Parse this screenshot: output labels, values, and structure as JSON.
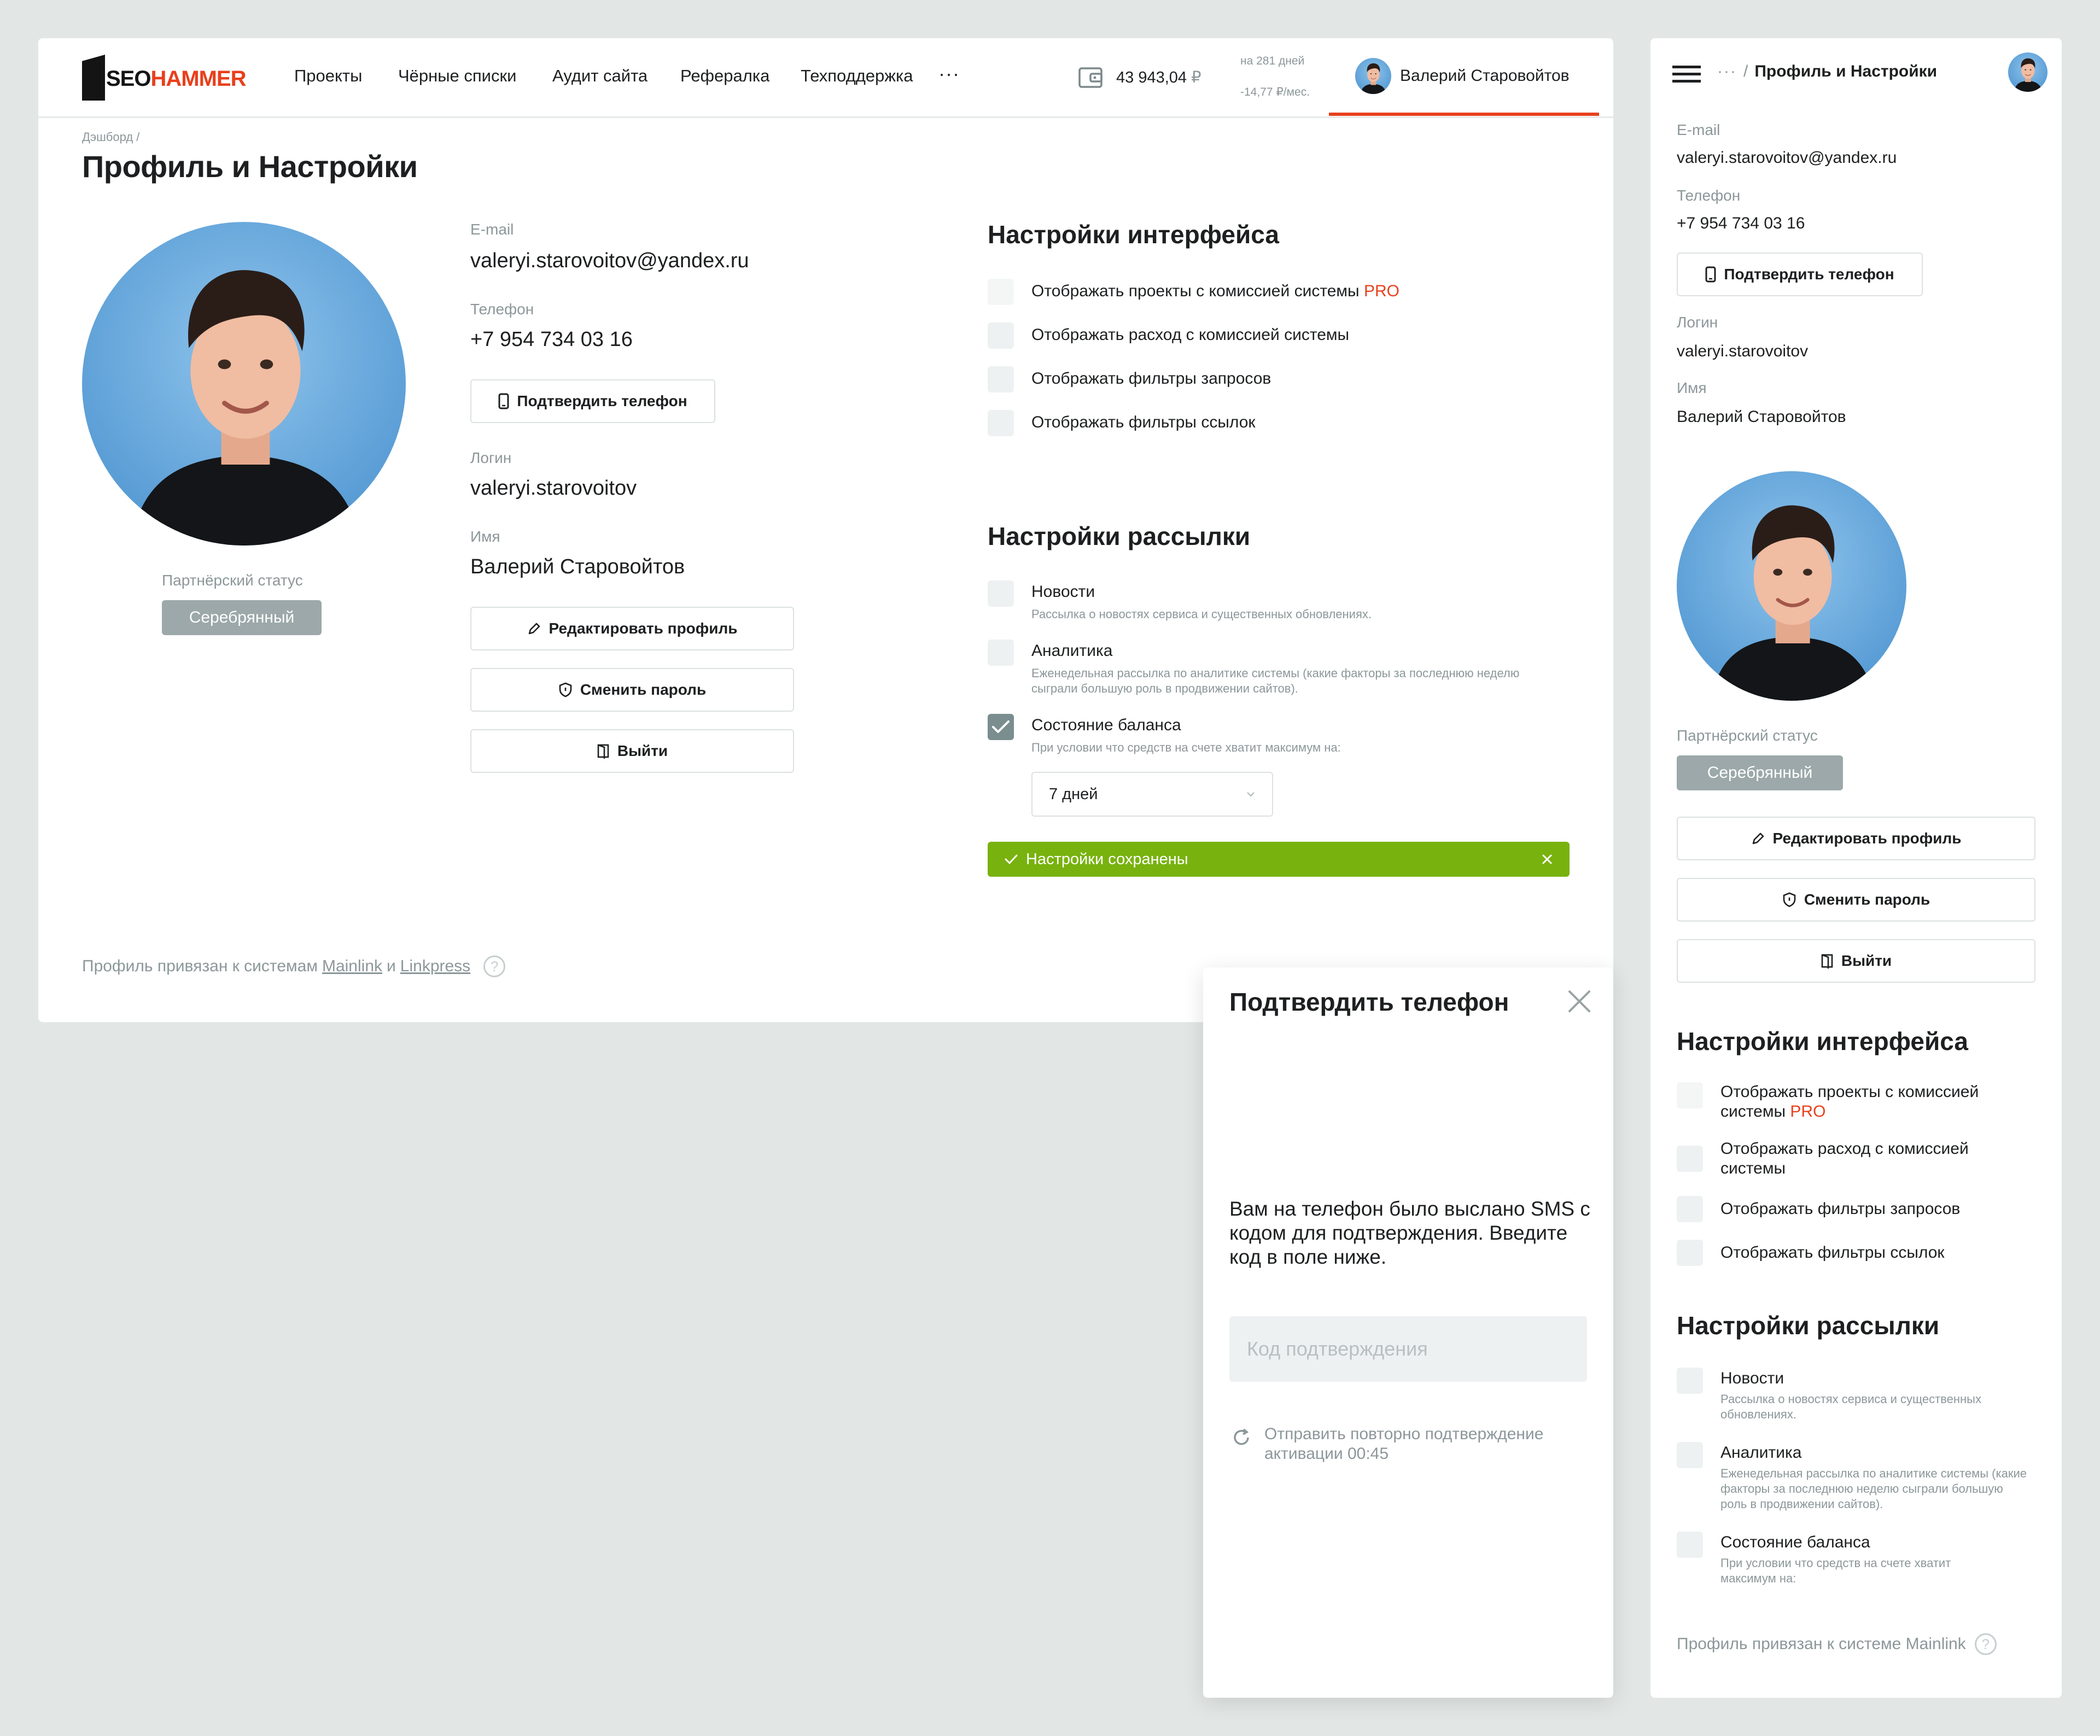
{
  "logo": {
    "part1": "SEO",
    "part2": "HAMMER"
  },
  "nav": {
    "items": [
      "Проекты",
      "Чёрные списки",
      "Аудит сайта",
      "Рефералка",
      "Техподдержка"
    ],
    "more": "···"
  },
  "wallet": {
    "amount": "43 943,04",
    "currency": "₽",
    "days": "на 281 дней",
    "per_month": "-14,77 ₽/мес."
  },
  "user": {
    "name": "Валерий Старовойтов"
  },
  "breadcrumb": "Дэшборд /",
  "page_title": "Профиль и Настройки",
  "profile": {
    "partner_status_label": "Партнёрский статус",
    "partner_status_value": "Серебрянный",
    "email_label": "E-mail",
    "email": "valeryi.starovoitov@yandex.ru",
    "phone_label": "Телефон",
    "phone": "+7 954 734 03 16",
    "confirm_phone_button": "Подтвердить телефон",
    "login_label": "Логин",
    "login": "valeryi.starovoitov",
    "name_label": "Имя",
    "name": "Валерий Старовойтов",
    "edit_button": "Редактировать профиль",
    "change_password_button": "Сменить пароль",
    "logout_button": "Выйти"
  },
  "interface_settings": {
    "title": "Настройки интерфейса",
    "options": [
      {
        "label": "Отображать проекты с комиссией системы",
        "suffix": "PRO",
        "state": "disabled"
      },
      {
        "label": "Отображать расход с комиссией системы",
        "state": "unchecked"
      },
      {
        "label": "Отображать фильтры запросов",
        "state": "unchecked"
      },
      {
        "label": "Отображать фильтры ссылок",
        "state": "unchecked"
      }
    ]
  },
  "mailing_settings": {
    "title": "Настройки рассылки",
    "options": [
      {
        "label": "Новости",
        "sub": "Рассылка о новостях сервиса и существенных обновлениях.",
        "state": "unchecked"
      },
      {
        "label": "Аналитика",
        "sub": "Еженедельная рассылка по аналитике системы (какие факторы за последнюю неделю сыграли большую роль в продвижении сайтов).",
        "state": "unchecked"
      },
      {
        "label": "Состояние баланса",
        "sub": "При условии что средств на счете хватит максимум на:",
        "state": "checked"
      }
    ],
    "balance_period": "7 дней"
  },
  "toast": {
    "text": "Настройки сохранены"
  },
  "linked": {
    "prefix": "Профиль привязан к системам",
    "system1": "Mainlink",
    "and": "и",
    "system2": "Linkpress"
  },
  "modal": {
    "title": "Подтвердить телефон",
    "text": "Вам на телефон было выслано SMS с кодом для подтверждения. Введите код в поле ниже.",
    "code_placeholder": "Код подтверждения",
    "resend": "Отправить повторно подтверждение активации 00:45"
  },
  "mobile": {
    "crumb_dots": "···",
    "crumb_slash": "/",
    "crumb_title": "Профиль и Настройки",
    "linked": "Профиль привязан к системе Mainlink"
  },
  "colors": {
    "accent": "#e8401c",
    "success": "#78b20e",
    "badge": "#9ca8a9"
  }
}
